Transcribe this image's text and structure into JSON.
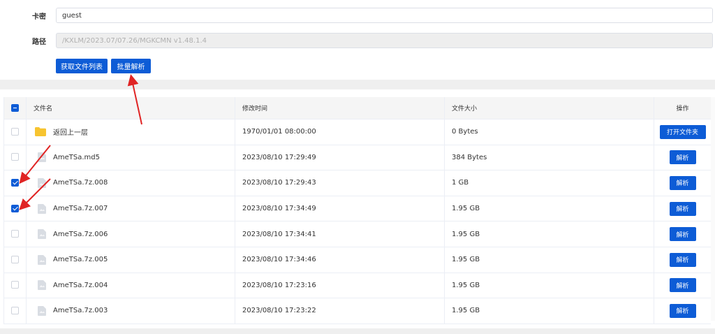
{
  "form": {
    "card_label": "卡密",
    "card_value": "guest",
    "path_label": "路径",
    "path_value": "/KXLM/2023.07/07.26/MGKCMN v1.48.1.4",
    "get_list_label": "获取文件列表",
    "batch_parse_label": "批量解析"
  },
  "table": {
    "columns": [
      "文件名",
      "修改时间",
      "文件大小",
      "操作"
    ],
    "rows": [
      {
        "name": "返回上一层",
        "time": "1970/01/01 08:00:00",
        "size": "0 Bytes",
        "action": "打开文件夹",
        "type": "folder",
        "checked": false
      },
      {
        "name": "AmeTSa.md5",
        "time": "2023/08/10 17:29:49",
        "size": "384 Bytes",
        "action": "解析",
        "type": "file",
        "checked": false
      },
      {
        "name": "AmeTSa.7z.008",
        "time": "2023/08/10 17:29:43",
        "size": "1 GB",
        "action": "解析",
        "type": "file",
        "checked": true
      },
      {
        "name": "AmeTSa.7z.007",
        "time": "2023/08/10 17:34:49",
        "size": "1.95 GB",
        "action": "解析",
        "type": "file",
        "checked": true
      },
      {
        "name": "AmeTSa.7z.006",
        "time": "2023/08/10 17:34:41",
        "size": "1.95 GB",
        "action": "解析",
        "type": "file",
        "checked": false
      },
      {
        "name": "AmeTSa.7z.005",
        "time": "2023/08/10 17:34:46",
        "size": "1.95 GB",
        "action": "解析",
        "type": "file",
        "checked": false
      },
      {
        "name": "AmeTSa.7z.004",
        "time": "2023/08/10 17:23:16",
        "size": "1.95 GB",
        "action": "解析",
        "type": "file",
        "checked": false
      },
      {
        "name": "AmeTSa.7z.003",
        "time": "2023/08/10 17:23:22",
        "size": "1.95 GB",
        "action": "解析",
        "type": "file",
        "checked": false
      }
    ]
  },
  "colors": {
    "primary": "#0d5cd6",
    "annotation_arrow": "#e02424",
    "folder": "#f7c430",
    "file_icon": "#d9dde3"
  },
  "icons": {
    "folder": "folder-icon",
    "file": "file-icon",
    "checkbox": "checkbox-icon"
  }
}
